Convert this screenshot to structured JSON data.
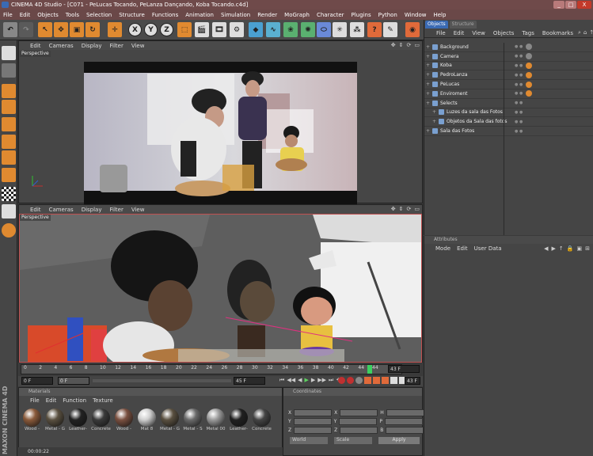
{
  "window": {
    "title": "CINEMA 4D Studio - [C071 - PeLucas Tocando, PeLanza Dançando, Koba Tocando.c4d]",
    "controls": [
      "_",
      "□",
      "X"
    ]
  },
  "menubar": [
    "File",
    "Edit",
    "Objects",
    "Tools",
    "Selection",
    "Structure",
    "Functions",
    "Animation",
    "Simulation",
    "Render",
    "MoGraph",
    "Character",
    "Plugins",
    "Python",
    "Window",
    "Help"
  ],
  "toolbar": {
    "axis_x": "X",
    "axis_y": "Y",
    "axis_z": "Z"
  },
  "viewport_top": {
    "menu": [
      "Edit",
      "Cameras",
      "Display",
      "Filter",
      "View"
    ],
    "label": "Perspective"
  },
  "viewport_bottom": {
    "menu": [
      "Edit",
      "Cameras",
      "Display",
      "Filter",
      "View"
    ],
    "label": "Perspective"
  },
  "timeline": {
    "ticks": [
      "0",
      "2",
      "4",
      "6",
      "8",
      "10",
      "12",
      "14",
      "16",
      "18",
      "20",
      "22",
      "24",
      "26",
      "28",
      "30",
      "32",
      "34",
      "36",
      "38",
      "40",
      "42",
      "44"
    ],
    "current_frame": "44",
    "end_frame": "43 F",
    "start_field": "0 F",
    "current_field": "0 F",
    "end_field": "45 F",
    "max_field": "43 F"
  },
  "materials": {
    "title": "Materials",
    "menu": [
      "File",
      "Edit",
      "Function",
      "Texture"
    ],
    "row1": [
      {
        "name": "Wood -",
        "color": "#8a5a3a"
      },
      {
        "name": "Metal - G",
        "color": "#5a5040"
      },
      {
        "name": "Leather-",
        "color": "#222222"
      },
      {
        "name": "Concrete",
        "color": "#3a3a3a"
      },
      {
        "name": "Wood -",
        "color": "#7a5040"
      },
      {
        "name": "Mat 8",
        "color": "#cfcfcf"
      },
      {
        "name": "Metal - G",
        "color": "#5a5040"
      },
      {
        "name": "Metal - S",
        "color": "#6a6a6a"
      },
      {
        "name": "Metal 00",
        "color": "#9a9a9a"
      },
      {
        "name": "Leather-",
        "color": "#202020"
      },
      {
        "name": "Concrete",
        "color": "#444444"
      }
    ],
    "row2_colors": [
      "#caa080",
      "#c68a6a",
      "#1a1a1a",
      "#d0d0d0",
      "#d8d8d8",
      "#6a6a6a",
      "#a07040",
      "#ffffff",
      "#e0a020",
      "#2050c0",
      "#404040"
    ]
  },
  "coordinates": {
    "title": "Coordinates",
    "rows": [
      [
        "X",
        "X",
        "H"
      ],
      [
        "Y",
        "Y",
        "P"
      ],
      [
        "Z",
        "Z",
        "B"
      ]
    ],
    "mode1": "World",
    "mode2": "Scale",
    "apply": "Apply"
  },
  "objects_panel": {
    "tabs": [
      "Objects",
      "Structure"
    ],
    "menu": [
      "File",
      "Edit",
      "View",
      "Objects",
      "Tags",
      "Bookmarks"
    ],
    "rows": [
      {
        "name": "Background",
        "indent": 0
      },
      {
        "name": "Camera",
        "indent": 0
      },
      {
        "name": "Koba",
        "indent": 0
      },
      {
        "name": "PedroLanza",
        "indent": 0
      },
      {
        "name": "PeLucas",
        "indent": 0
      },
      {
        "name": "Enviroment",
        "indent": 0
      },
      {
        "name": "Selects",
        "indent": 0
      },
      {
        "name": "Luzes da sala das Fotos",
        "indent": 1
      },
      {
        "name": "Objetos da Sala das fotos",
        "indent": 1
      },
      {
        "name": "Sala das Fotos",
        "indent": 0
      }
    ]
  },
  "attributes_panel": {
    "title": "Attributes",
    "menu": [
      "Mode",
      "Edit",
      "User Data"
    ]
  },
  "status": {
    "time": "00:00:22"
  },
  "brand": "MAXON CINEMA 4D",
  "colors": {
    "title_bar": "#6f4a4a",
    "selection": "#3a6ab3",
    "timeline_marker": "#3cd060"
  }
}
